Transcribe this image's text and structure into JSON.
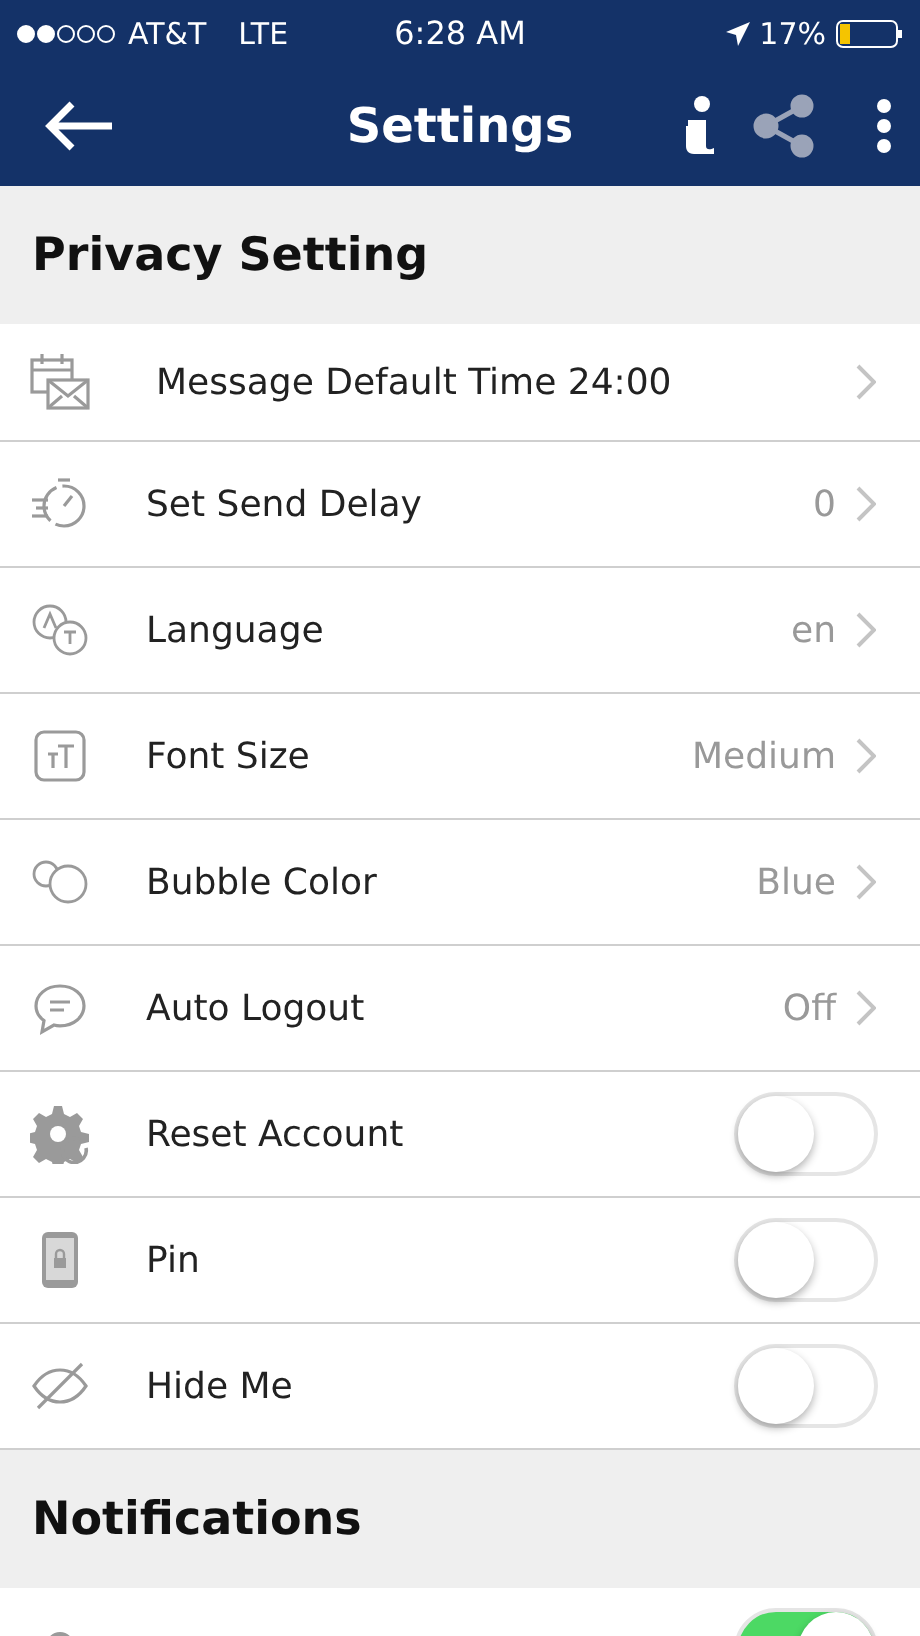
{
  "status_bar": {
    "carrier": "AT&T",
    "network": "LTE",
    "time": "6:28 AM",
    "battery": "17%"
  },
  "nav": {
    "title": "Settings"
  },
  "sections": [
    {
      "title": "Privacy Setting",
      "rows": [
        {
          "kind": "link",
          "label": "Message Default Time 24:00"
        },
        {
          "kind": "link",
          "label": "Set Send Delay",
          "value": "0"
        },
        {
          "kind": "link",
          "label": "Language",
          "value": "en"
        },
        {
          "kind": "link",
          "label": "Font Size",
          "value": "Medium"
        },
        {
          "kind": "link",
          "label": "Bubble Color",
          "value": "Blue"
        },
        {
          "kind": "link",
          "label": "Auto Logout",
          "value": "Off"
        },
        {
          "kind": "toggle",
          "label": "Reset Account",
          "on": false
        },
        {
          "kind": "toggle",
          "label": "Pin",
          "on": false
        },
        {
          "kind": "toggle",
          "label": "Hide Me",
          "on": false
        }
      ]
    },
    {
      "title": "Notifications",
      "rows": [
        {
          "kind": "toggle",
          "on": true
        }
      ]
    }
  ]
}
